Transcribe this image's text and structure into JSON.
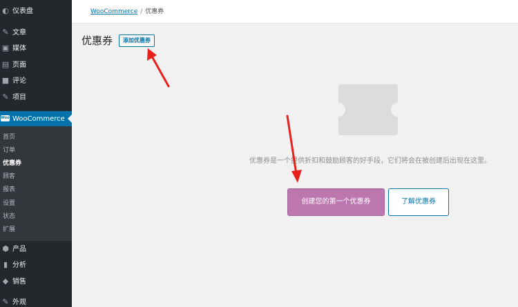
{
  "sidebar": {
    "items": [
      {
        "label": "仪表盘",
        "icon": "dashboard-icon"
      },
      {
        "label": "文章",
        "icon": "pin-icon"
      },
      {
        "label": "媒体",
        "icon": "media-icon"
      },
      {
        "label": "页面",
        "icon": "page-icon"
      },
      {
        "label": "评论",
        "icon": "comment-icon"
      },
      {
        "label": "项目",
        "icon": "pin-icon"
      }
    ],
    "woocommerce": {
      "label": "WooCommerce",
      "badge": "Woo"
    },
    "submenu": [
      "首页",
      "订单",
      "优惠券",
      "顾客",
      "报表",
      "设置",
      "状态",
      "扩展"
    ],
    "active_submenu": "优惠券",
    "bottom_items": [
      {
        "label": "产品",
        "icon": "box-icon"
      },
      {
        "label": "分析",
        "icon": "bar-chart-icon"
      },
      {
        "label": "销售",
        "icon": "megaphone-icon"
      },
      {
        "label": "外观",
        "icon": "brush-icon"
      }
    ]
  },
  "breadcrumb": {
    "root": "WooCommerce",
    "separator": "/",
    "current": "优惠券"
  },
  "header": {
    "title": "优惠券",
    "add_button": "添加优惠券"
  },
  "empty_state": {
    "icon": "coupon-icon",
    "message": "优惠券是一个提供折扣和鼓励顾客的好手段，它们将会在被创建后出现在这里。",
    "primary_button": "创建您的第一个优惠券",
    "secondary_button": "了解优惠券"
  },
  "colors": {
    "sidebar": "#23282d",
    "submenu": "#32373c",
    "accent": "#0073aa",
    "woo_purple": "#bb77ae",
    "annotation_red": "#e8201b"
  }
}
